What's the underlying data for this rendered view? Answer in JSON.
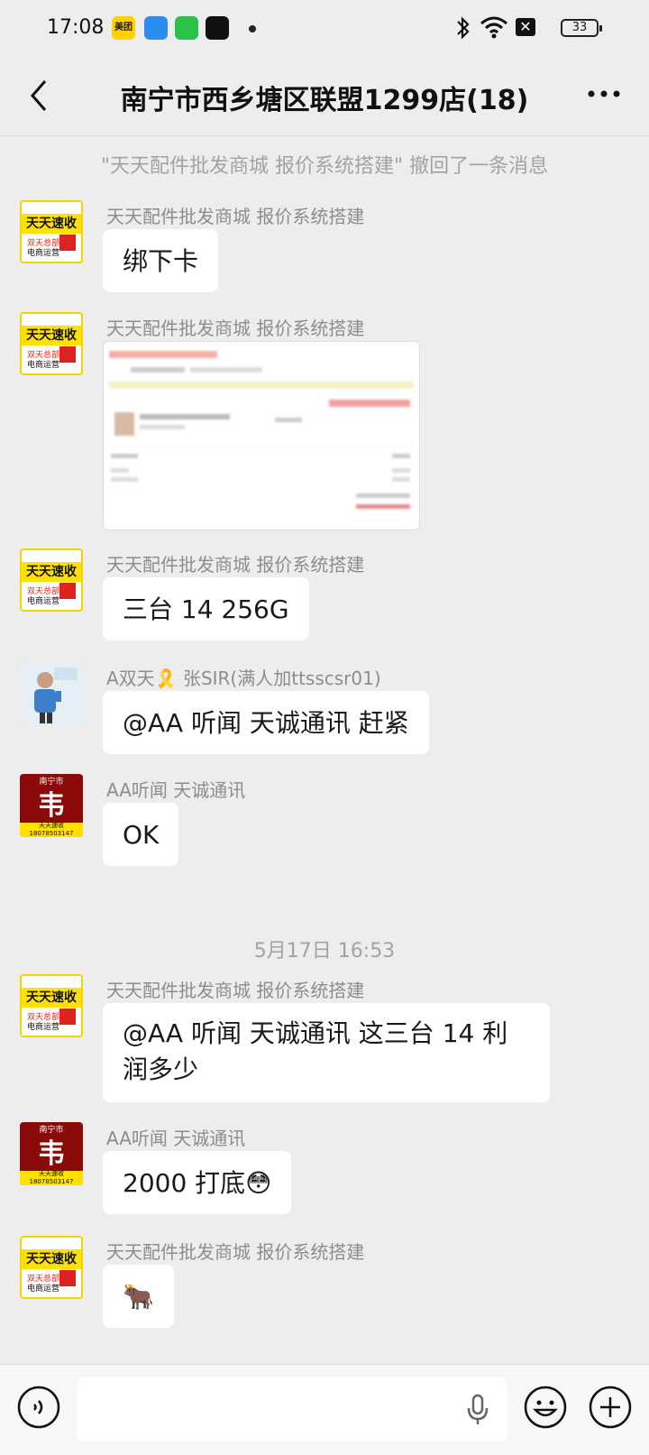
{
  "status": {
    "time": "17:08",
    "battery": "33",
    "app_badge_meituan": "美团"
  },
  "header": {
    "title": "南宁市西乡塘区联盟1299店(18)"
  },
  "recall_notice": "\"天天配件批发商城 报价系统搭建\" 撤回了一条消息",
  "timestamp": "5月17日 16:53",
  "avatar_text": {
    "yellow_main": "天天速收",
    "yellow_sub": "双天总部",
    "yellow_bottom": "电商运营",
    "red_top": "南宁市",
    "red_char": "韦",
    "red_bottom": "天天速收",
    "red_phone": "18078503147"
  },
  "messages": [
    {
      "sender": "天天配件批发商城 报价系统搭建",
      "text": "绑下卡"
    },
    {
      "sender": "天天配件批发商城 报价系统搭建",
      "type": "image"
    },
    {
      "sender": "天天配件批发商城 报价系统搭建",
      "text": "三台 14 256G"
    },
    {
      "sender": "A双天🎗️ 张SIR(满人加ttsscsr01)",
      "text": "@AA 听闻 天诚通讯  赶紧"
    },
    {
      "sender": "AA听闻 天诚通讯",
      "text": "OK"
    },
    {
      "sender": "天天配件批发商城 报价系统搭建",
      "text_line1": "@AA 听闻 天诚通讯  这三台 14 利",
      "text_line2": "润多少"
    },
    {
      "sender": "AA听闻 天诚通讯",
      "text": "2000 打底😳"
    },
    {
      "sender": "天天配件批发商城 报价系统搭建",
      "text": "🐂"
    }
  ],
  "icons": [
    "back-icon",
    "more-icon",
    "voice-icon",
    "microphone-icon",
    "emoji-icon",
    "plus-icon"
  ]
}
